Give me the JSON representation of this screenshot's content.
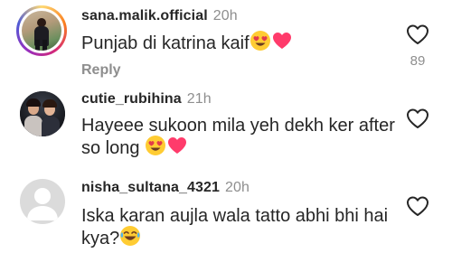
{
  "comments": [
    {
      "username": "sana.malik.official",
      "time": "20h",
      "text": "Punjab di katrina kaif",
      "emojis": [
        "heart-eyes-emoji",
        "heart-emoji"
      ],
      "reply_label": "Reply",
      "like_count": "89",
      "avatar": "photo-avatar-story-ring"
    },
    {
      "username": "cutie_rubihina",
      "time": "21h",
      "text_line1": "Hayeee sukoon mila yeh dekh ker after",
      "text_line2": "so long",
      "emojis": [
        "heart-eyes-emoji",
        "heart-emoji"
      ],
      "avatar": "photo-avatar"
    },
    {
      "username": "nisha_sultana_4321",
      "time": "20h",
      "text_line1": "Iska karan aujla wala tatto abhi bhi hai",
      "text_line2": "kya?",
      "emojis": [
        "laughing-tears-emoji"
      ],
      "avatar": "default-avatar"
    }
  ],
  "colors": {
    "text": "#262626",
    "muted": "#8e8e8e",
    "heart": "#ed4956",
    "story_ring_start": "#feda75",
    "story_ring_end": "#d62976"
  }
}
